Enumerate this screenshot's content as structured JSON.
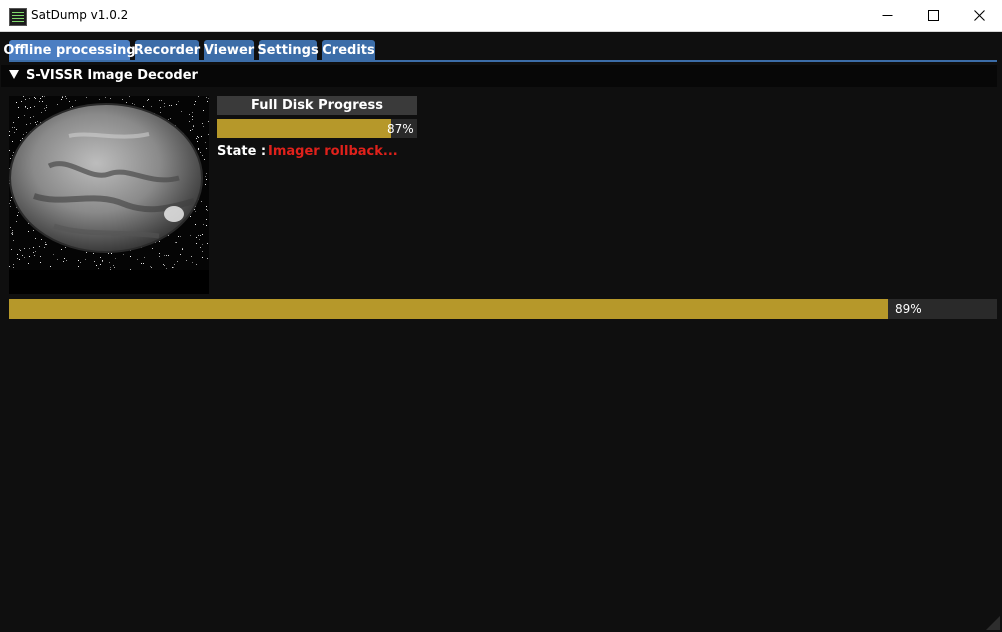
{
  "window": {
    "title": "SatDump v1.0.2",
    "app_icon": "satdump-icon",
    "controls": [
      "minimize-icon",
      "maximize-icon",
      "close-icon"
    ]
  },
  "tabs": [
    {
      "label": "Offline processing",
      "active": true
    },
    {
      "label": "Recorder",
      "active": false
    },
    {
      "label": "Viewer",
      "active": false
    },
    {
      "label": "Settings",
      "active": false
    },
    {
      "label": "Credits",
      "active": false
    }
  ],
  "decoder": {
    "title": "S-VISSR Image Decoder",
    "collapse_icon": "triangle-down-icon",
    "full_disk_button": "Full Disk Progress",
    "full_disk_progress": {
      "value": 0.87,
      "label": "87%"
    },
    "state_label": "State :",
    "state_value": "Imager rollback...",
    "overall_progress": {
      "value": 0.89,
      "label": "89%"
    }
  },
  "colors": {
    "background": "#0f0f0f",
    "tab": "#3c6da8",
    "progress_fill": "#b6982a",
    "state_text": "#e0211b"
  }
}
